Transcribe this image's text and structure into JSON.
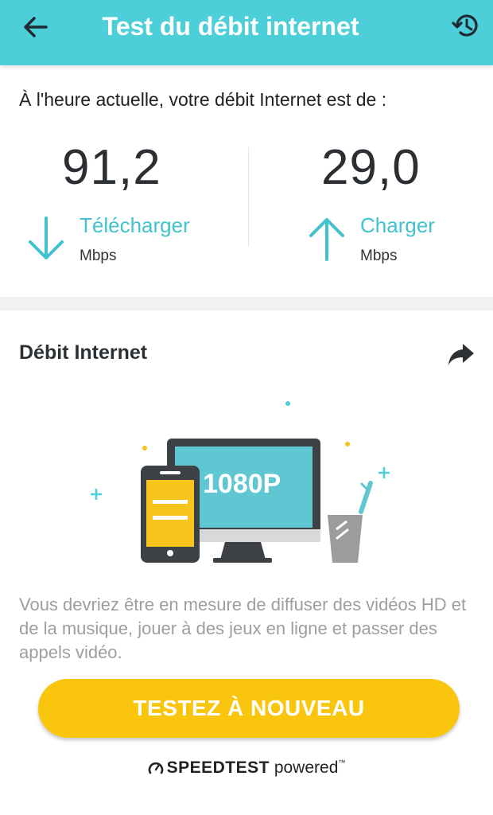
{
  "header": {
    "title": "Test du débit internet",
    "back_icon": "arrow-left-icon",
    "history_icon": "history-icon"
  },
  "results": {
    "label": "À l'heure actuelle, votre débit Internet est de :",
    "download": {
      "value": "91,2",
      "label": "Télécharger",
      "unit": "Mbps",
      "icon": "arrow-down-icon"
    },
    "upload": {
      "value": "29,0",
      "label": "Charger",
      "unit": "Mbps",
      "icon": "arrow-up-icon"
    }
  },
  "section": {
    "title": "Débit Internet",
    "share_icon": "share-icon"
  },
  "illustration": {
    "screen_text": "1080P"
  },
  "description": "Vous devriez être en mesure de diffuser des vidéos HD et de la musique, jouer à des jeux en ligne et passer des appels vidéo.",
  "retest_button": "TESTEZ À NOUVEAU",
  "powered_by": {
    "brand": "SPEEDTEST",
    "suffix": "powered",
    "trademark": "™"
  },
  "colors": {
    "header": "#4ccfd8",
    "accent": "#41c2cc",
    "button": "#f9c50d",
    "description_text": "#9e9e9e"
  }
}
